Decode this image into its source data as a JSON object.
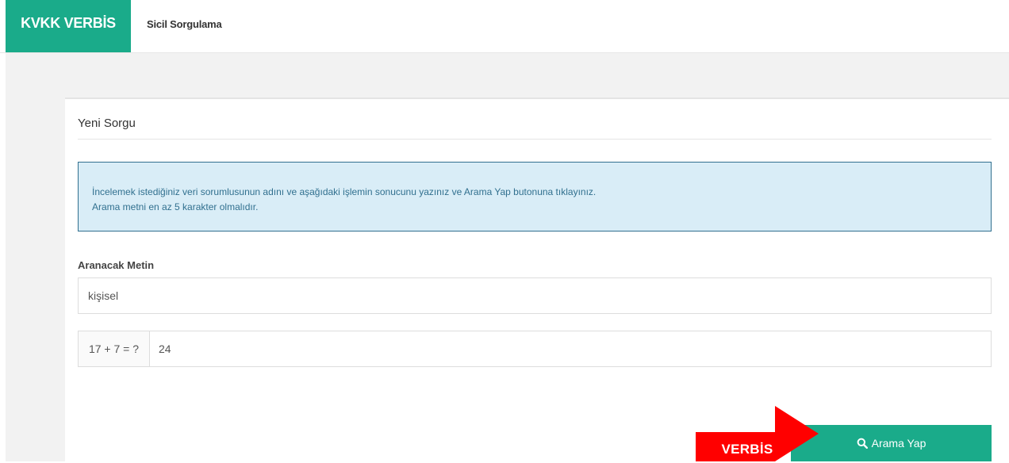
{
  "header": {
    "brand": "KVKK VERBİS",
    "nav_link": "Sicil Sorgulama"
  },
  "panel": {
    "title": "Yeni Sorgu",
    "info_line1": "İncelemek istediğiniz veri sorumlusunun adını ve aşağıdaki işlemin sonucunu yazınız ve Arama Yap butonuna tıklayınız.",
    "info_line2": "Arama metni en az 5 karakter olmalıdır."
  },
  "form": {
    "search_label": "Aranacak Metin",
    "search_value": "kişisel",
    "captcha_question": "17 + 7 = ?",
    "captcha_value": "24",
    "submit_label": "Arama Yap",
    "submit_icon": "search-icon"
  },
  "annotation": {
    "label": "VERBİS",
    "color": "#ff0000"
  },
  "colors": {
    "brand": "#1aab8a",
    "info_bg": "#d9edf7",
    "info_border": "#31708f"
  }
}
